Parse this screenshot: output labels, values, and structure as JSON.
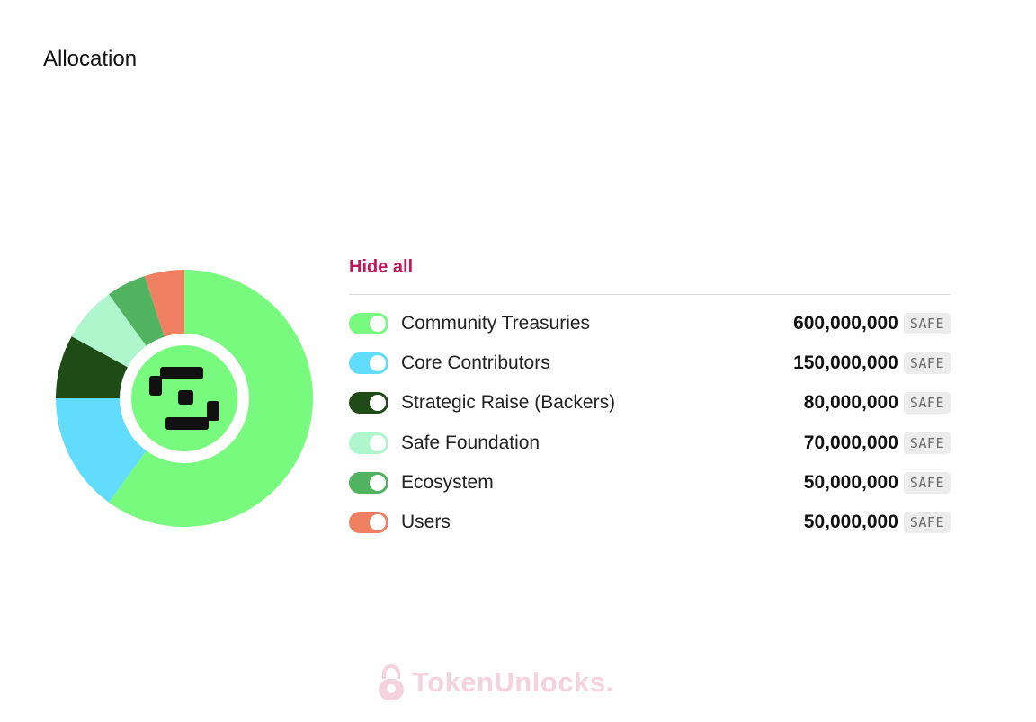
{
  "title": "Allocation",
  "hide_all_label": "Hide all",
  "watermark": "TokenUnlocks.",
  "unit_label": "SAFE",
  "chart_data": {
    "type": "pie",
    "donut": true,
    "categories": [
      "Community Treasuries",
      "Core Contributors",
      "Strategic Raise (Backers)",
      "Safe Foundation",
      "Ecosystem",
      "Users"
    ],
    "values": [
      600000000,
      150000000,
      80000000,
      70000000,
      50000000,
      50000000
    ],
    "colors": [
      "#77fa7e",
      "#62dcfd",
      "#1e4b16",
      "#aef7cc",
      "#51b35f",
      "#ef8061"
    ],
    "legend_position": "right"
  },
  "legend": [
    {
      "label": "Community Treasuries",
      "value": "600,000,000",
      "color": "#77fa7e"
    },
    {
      "label": "Core Contributors",
      "value": "150,000,000",
      "color": "#62dcfd"
    },
    {
      "label": "Strategic Raise (Backers)",
      "value": "80,000,000",
      "color": "#1e4b16"
    },
    {
      "label": "Safe Foundation",
      "value": "70,000,000",
      "color": "#aef7cc"
    },
    {
      "label": "Ecosystem",
      "value": "50,000,000",
      "color": "#51b35f"
    },
    {
      "label": "Users",
      "value": "50,000,000",
      "color": "#ef8061"
    }
  ],
  "icons": {
    "center_logo": "safe-logo-icon",
    "watermark_logo": "lock-icon"
  }
}
